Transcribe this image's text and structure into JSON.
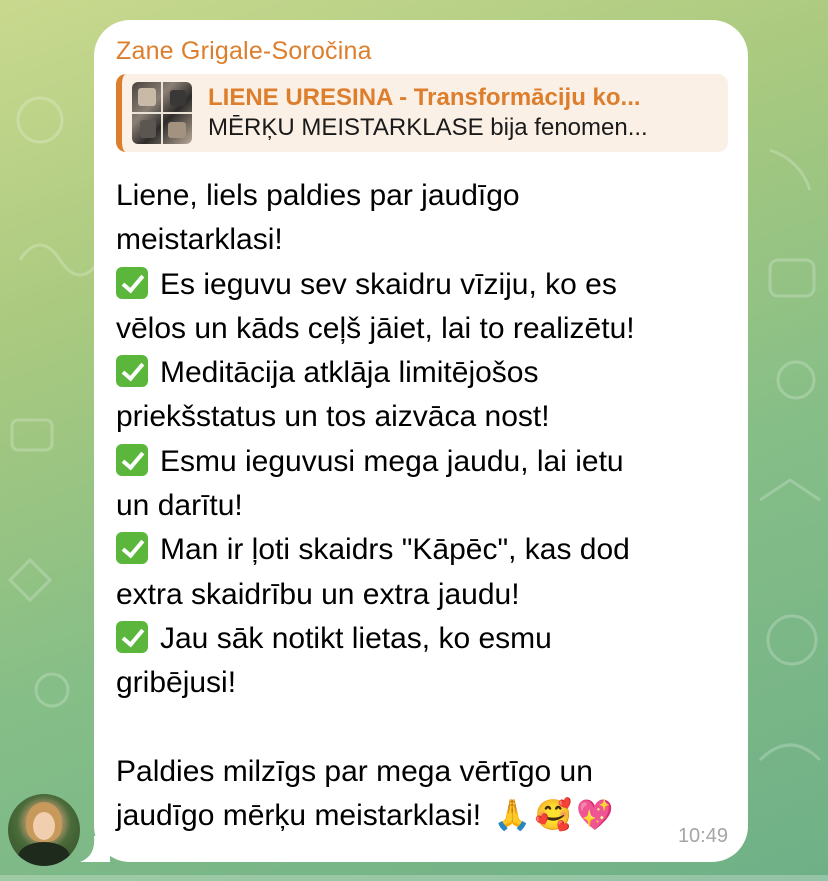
{
  "sender_name": "Zane Grigale-Soročina",
  "reply": {
    "title": "LIENE URESINA - Transformāciju ko...",
    "snippet": "MĒRĶU MEISTARKLASE bija fenomen..."
  },
  "message_lines": [
    "Liene, liels paldies par jaudīgo",
    "meistarklasi!",
    "Es ieguvu sev skaidru vīziju, ko es",
    "vēlos un kāds ceļš jāiet, lai to realizētu!",
    "Meditācija atklāja limitējošos",
    "priekšstatus un tos aizvāca nost!",
    "Esmu ieguvusi mega jaudu, lai ietu",
    "un darītu!",
    "Man ir ļoti skaidrs \"Kāpēc\", kas dod",
    "extra skaidrību un extra jaudu!",
    "Jau sāk notikt lietas, ko esmu",
    "gribējusi!",
    "",
    "Paldies milzīgs par mega vērtīgo un",
    "jaudīgo mērķu meistarklasi!"
  ],
  "emojis": {
    "pray": "🙏",
    "smiling_hearts": "🥰",
    "sparkling_heart": "💖"
  },
  "timestamp": "10:49",
  "colors": {
    "sender": "#dd7e2d",
    "check": "#5bb73c",
    "bubble": "#ffffff",
    "time": "#a5a5a5"
  },
  "icons": {
    "check_mark": "check-mark-icon",
    "avatar": "avatar"
  }
}
